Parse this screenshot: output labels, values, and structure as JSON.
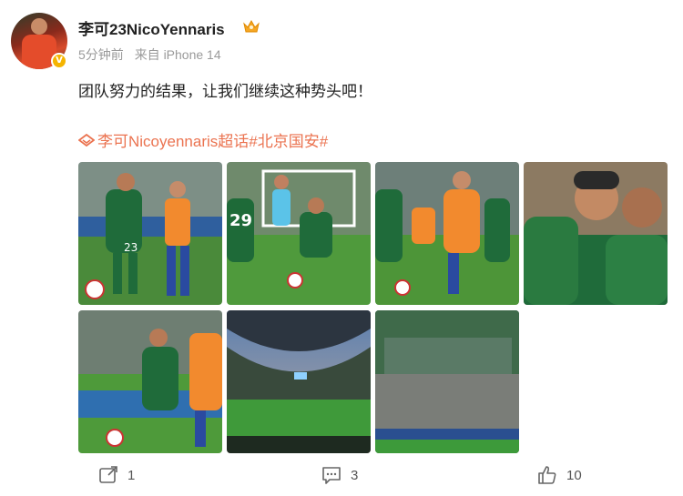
{
  "post": {
    "username": "李可23NicoYennaris",
    "meta": {
      "time": "5分钟前",
      "source": "来自 iPhone 14"
    },
    "text": "团队努力的结果，让我们继续这种势头吧！",
    "topics": [
      "李可Nicoyennaris超话",
      "#北京国安#"
    ],
    "photos": [
      "photo-1",
      "photo-2",
      "photo-3",
      "photo-4",
      "photo-5",
      "photo-6",
      "photo-7"
    ]
  },
  "actions": {
    "reposts": "1",
    "comments": "3",
    "likes": "10"
  },
  "colors": {
    "topic": "#eb7350",
    "meta": "#9a9a9a",
    "verified": "#f5b400"
  },
  "icons": {
    "repost": "share-icon",
    "comment": "comment-icon",
    "like": "thumbs-up-icon",
    "crown": "crown-icon",
    "topic": "supertopic-icon"
  },
  "photo_texts": {
    "jersey_23": "23",
    "jersey_29": "29"
  }
}
